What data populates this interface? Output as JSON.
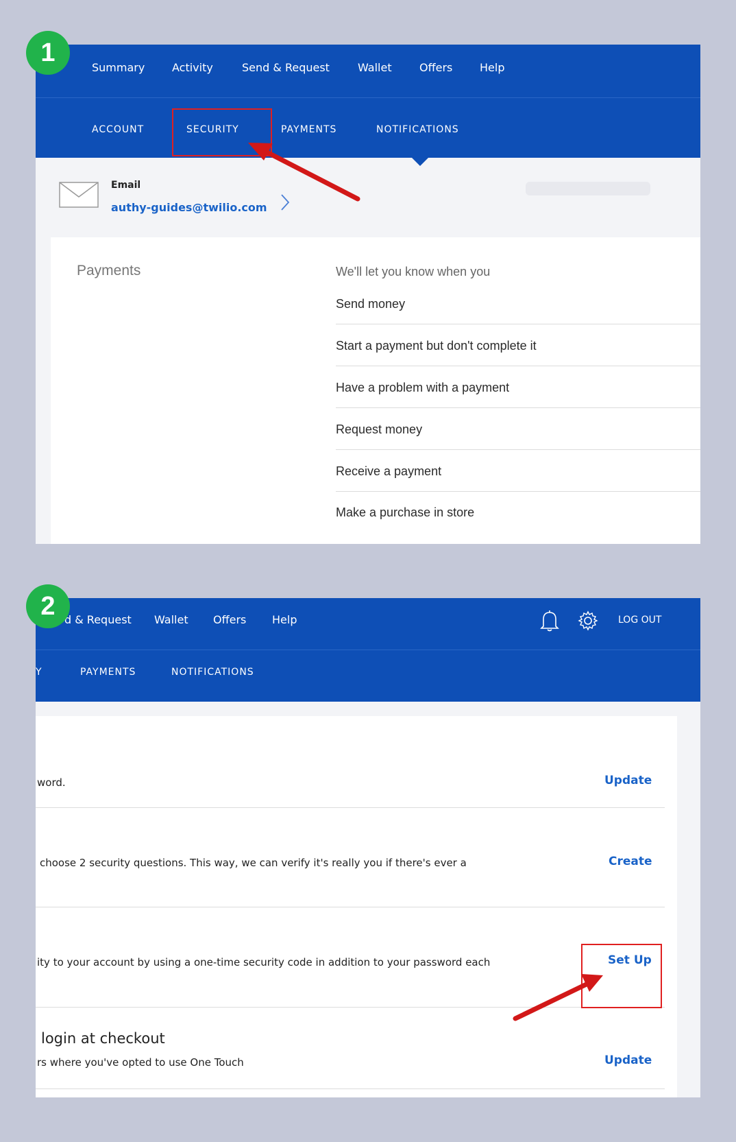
{
  "badges": [
    "1",
    "2"
  ],
  "panel1": {
    "nav": [
      "Summary",
      "Activity",
      "Send & Request",
      "Wallet",
      "Offers",
      "Help"
    ],
    "subnav": [
      "ACCOUNT",
      "SECURITY",
      "PAYMENTS",
      "NOTIFICATIONS"
    ],
    "email": {
      "label": "Email",
      "value": "authy-guides@twilio.com"
    },
    "payments": {
      "heading": "Payments",
      "intro": "We'll let you know when you",
      "items": [
        "Send money",
        "Start a payment but don't complete it",
        "Have a problem with a payment",
        "Request money",
        "Receive a payment",
        "Make a purchase in store"
      ]
    }
  },
  "panel2": {
    "nav": [
      "d & Request",
      "Wallet",
      "Offers",
      "Help"
    ],
    "logout": "LOG OUT",
    "subnav": [
      "Y",
      "PAYMENTS",
      "NOTIFICATIONS"
    ],
    "rows": [
      {
        "desc": "word.",
        "action": "Update"
      },
      {
        "desc": "choose 2 security questions. This way, we can verify it's really you if there's ever a",
        "action": "Create"
      },
      {
        "desc": "ity to your account by using a one-time security code in addition to your password each",
        "action": "Set Up"
      },
      {
        "title": "login at checkout",
        "desc": "rs where you've opted to use One Touch",
        "action": "Update"
      }
    ]
  },
  "colors": {
    "nav_blue": "#0e4fb6",
    "link_blue": "#1a63c8",
    "highlight_red": "#e02020",
    "badge_green": "#21b34b"
  }
}
